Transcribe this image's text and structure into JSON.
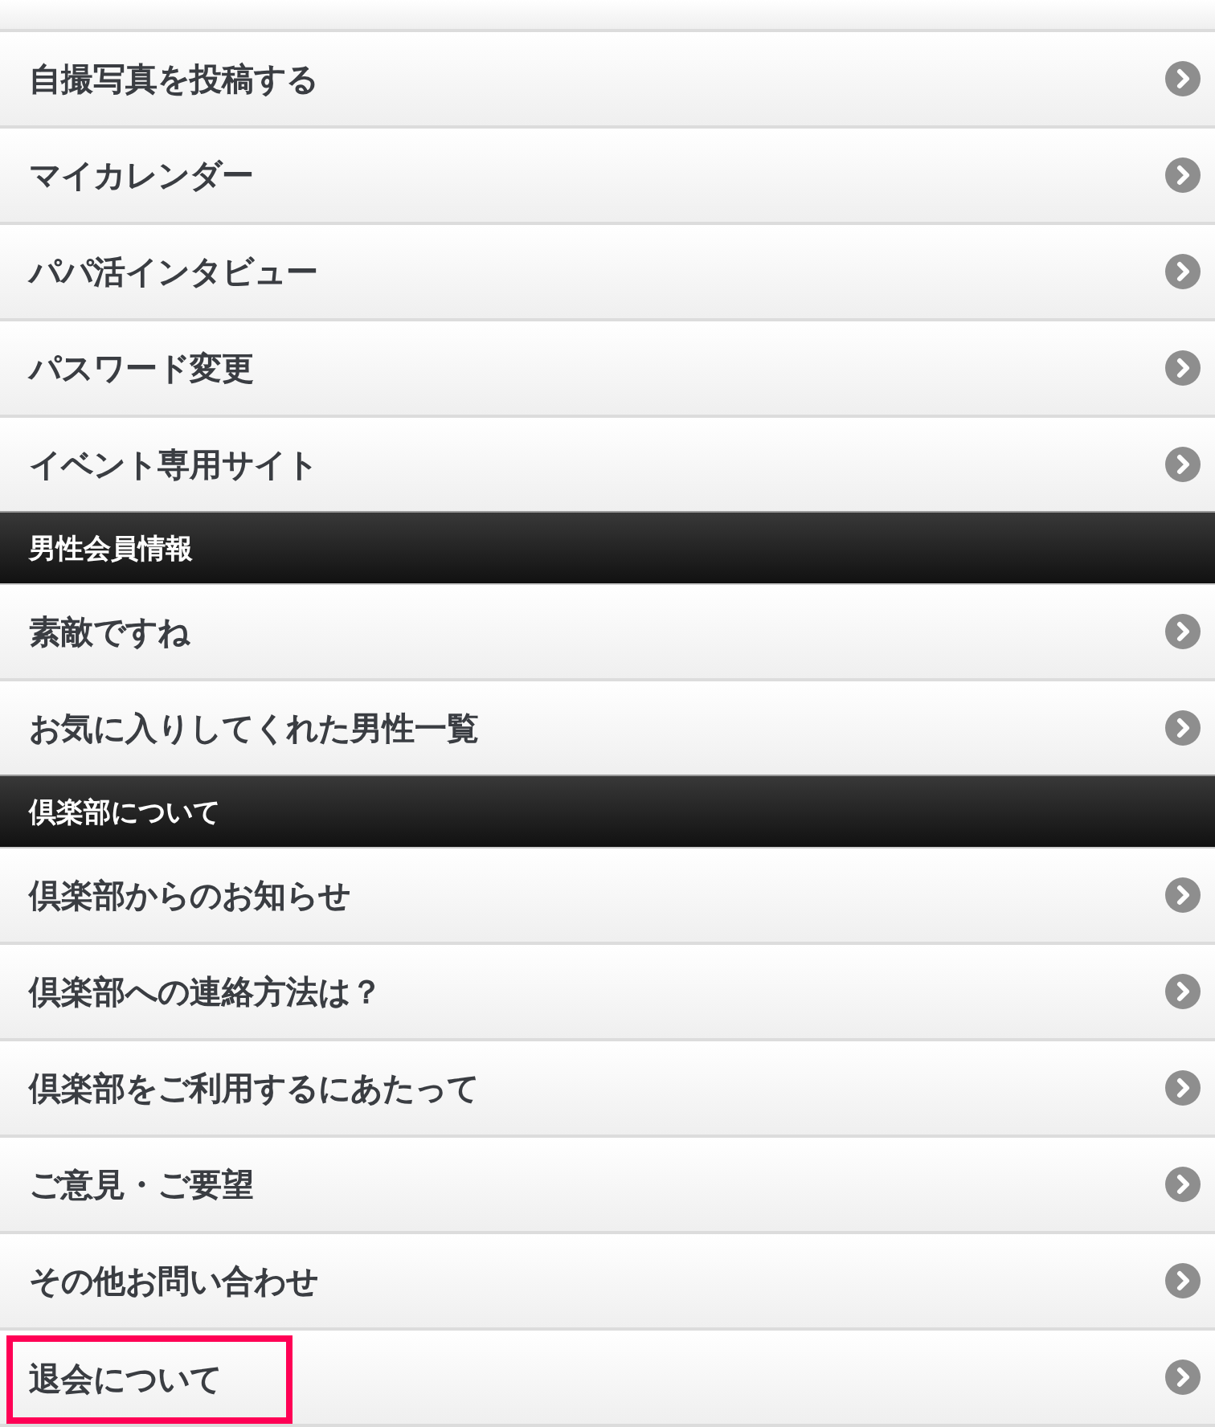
{
  "sections": [
    {
      "items": [
        {
          "label": "自撮写真を投稿する",
          "highlighted": false
        },
        {
          "label": "マイカレンダー",
          "highlighted": false
        },
        {
          "label": "パパ活インタビュー",
          "highlighted": false
        },
        {
          "label": "パスワード変更",
          "highlighted": false
        },
        {
          "label": "イベント専用サイト",
          "highlighted": false
        }
      ]
    },
    {
      "title": "男性会員情報",
      "items": [
        {
          "label": "素敵ですね",
          "highlighted": false
        },
        {
          "label": "お気に入りしてくれた男性一覧",
          "highlighted": false
        }
      ]
    },
    {
      "title": "倶楽部について",
      "items": [
        {
          "label": "倶楽部からのお知らせ",
          "highlighted": false
        },
        {
          "label": "倶楽部への連絡方法は？",
          "highlighted": false
        },
        {
          "label": "倶楽部をご利用するにあたって",
          "highlighted": false
        },
        {
          "label": "ご意見・ご要望",
          "highlighted": false
        },
        {
          "label": "その他お問い合わせ",
          "highlighted": false
        },
        {
          "label": "退会について",
          "highlighted": true
        }
      ]
    }
  ]
}
